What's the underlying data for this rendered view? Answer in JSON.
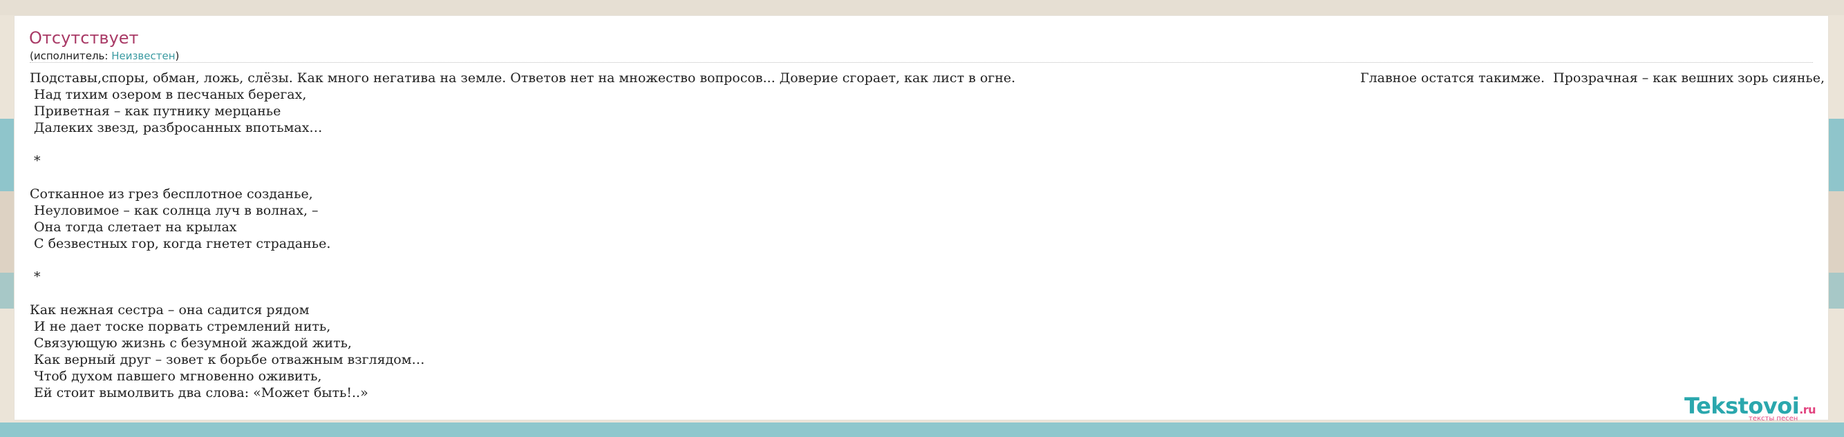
{
  "song": {
    "title": "Отсутствует",
    "performer_prefix": "(исполнитель: ",
    "performer": "Неизвестен",
    "performer_suffix": ")"
  },
  "lyrics": {
    "first_line_left": "Подставы,споры, обман, ложь, слёзы. Как много негатива на земле. Ответов нет на множество вопросов... Доверие сгорает, как лист в огне.",
    "first_line_right": "Главное остатся такимже.  Прозрачная – как вешних зорь сиянье,",
    "lines": [
      " Над тихим озером в песчаных берегах,",
      " Приветная – как путнику мерцанье",
      " Далеких звезд, разбросанных впотьмах…",
      "",
      " *",
      "",
      "Сотканное из грез бесплотное созданье,",
      " Неуловимое – как солнца луч в волнах, –",
      " Она тогда слетает на крылах",
      " С безвестных гор, когда гнетет страданье.",
      "",
      " *",
      "",
      "Как нежная сестра – она садится рядом",
      " И не дает тоске порвать стремлений нить,",
      " Связующую жизнь с безумной жаждой жить,",
      " Как верный друг – зовет к борьбе отважным взглядом…",
      " Чтоб духом павшего мгновенно оживить,",
      " Ей стоит вымолвить два слова: «Может быть!..»"
    ]
  },
  "logo": {
    "name": "Tekstovoi",
    "tld": ".ru",
    "tagline": "тексты песен"
  },
  "colors": {
    "title": "#a93a66",
    "link": "#3a9aa1",
    "logo": "#2aa7ad",
    "logo_accent": "#e2447f"
  }
}
